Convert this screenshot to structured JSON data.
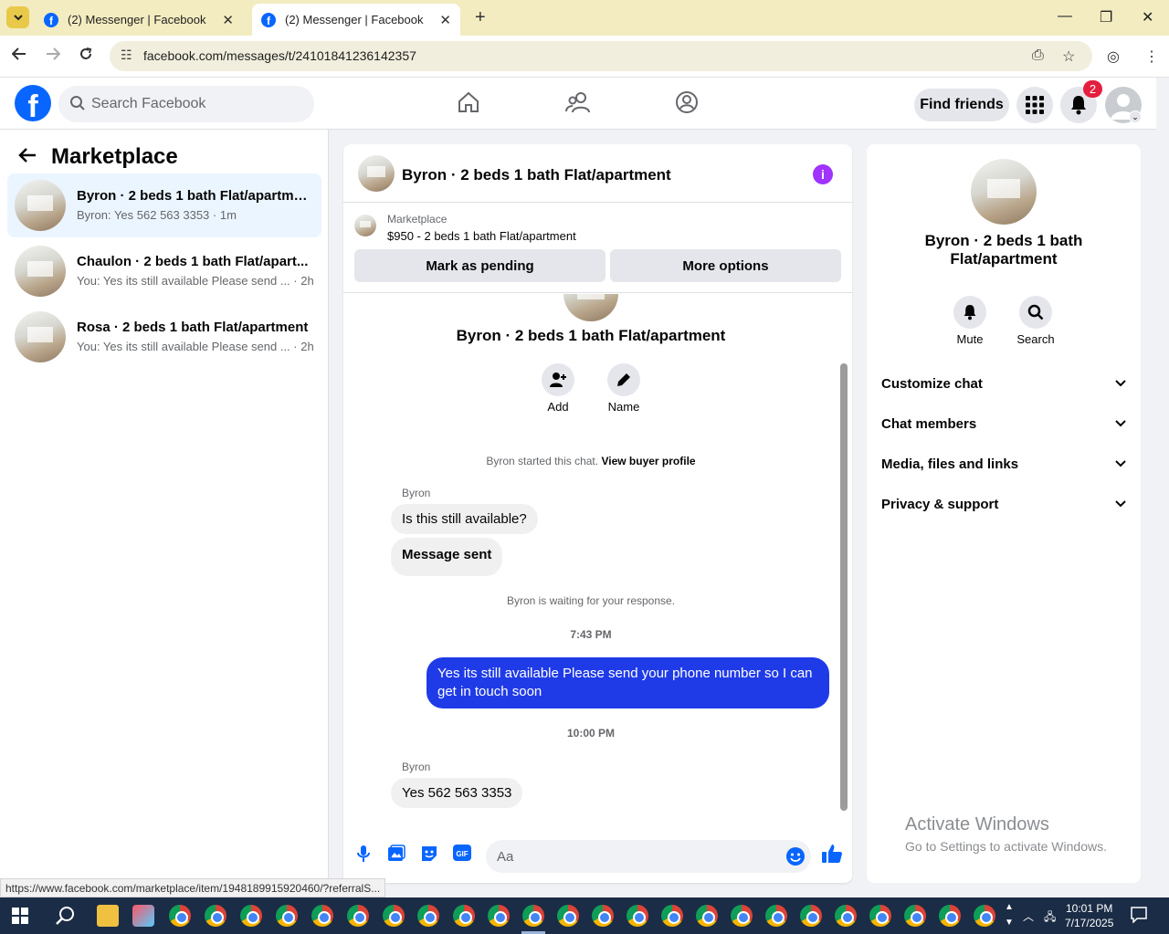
{
  "browser": {
    "tabs": [
      {
        "title": "(2) Messenger | Facebook",
        "active": false
      },
      {
        "title": "(2) Messenger | Facebook",
        "active": true
      }
    ],
    "url": "facebook.com/messages/t/24101841236142357",
    "status_url": "https://www.facebook.com/marketplace/item/1948189915920460/?referralS..."
  },
  "fb_header": {
    "search_placeholder": "Search Facebook",
    "find_friends_label": "Find friends",
    "notification_count": "2"
  },
  "sidebar": {
    "title": "Marketplace",
    "conversations": [
      {
        "title": "Byron · 2 beds 1 bath Flat/apartme...",
        "preview": "Byron: Yes 562 563 3353 · 1m",
        "selected": true
      },
      {
        "title": "Chaulon · 2 beds 1 bath Flat/apart...",
        "preview": "You: Yes its still available Please send ... · 2h",
        "selected": false
      },
      {
        "title": "Rosa · 2 beds 1 bath Flat/apartment",
        "preview": "You: Yes its still available Please send ... · 2h",
        "selected": false
      }
    ]
  },
  "chat": {
    "header_title": "Byron · 2 beds 1 bath Flat/apartment",
    "listing_label": "Marketplace",
    "listing_price": "$950 - 2 beds 1 bath Flat/apartment",
    "mark_pending_label": "Mark as pending",
    "more_options_label": "More options",
    "hero_name": "Byron · 2 beds 1 bath Flat/apartment",
    "add_label": "Add",
    "name_label": "Name",
    "started_text": "Byron started this chat.",
    "view_profile_label": "View buyer profile",
    "sender_1": "Byron",
    "msg_1": "Is this still available?",
    "msg_2": "Message sent",
    "waiting_text": "Byron is waiting for your response.",
    "time_1": "7:43 PM",
    "msg_out": "Yes its still available Please send your phone number so I can get in touch soon",
    "time_2": "10:00 PM",
    "sender_2": "Byron",
    "msg_3": "Yes 562 563 3353",
    "input_placeholder": "Aa"
  },
  "details": {
    "title": "Byron · 2 beds 1 bath Flat/apartment",
    "mute_label": "Mute",
    "search_label": "Search",
    "sections": [
      "Customize chat",
      "Chat members",
      "Media, files and links",
      "Privacy & support"
    ]
  },
  "windows": {
    "activate_title": "Activate Windows",
    "activate_sub": "Go to Settings to activate Windows.",
    "time": "10:01 PM",
    "date": "7/17/2025"
  },
  "colors": {
    "fb_blue": "#0866ff",
    "outgoing_bubble": "#1f3be8",
    "info_icon": "#a033ff",
    "badge_red": "#e41e3f"
  }
}
